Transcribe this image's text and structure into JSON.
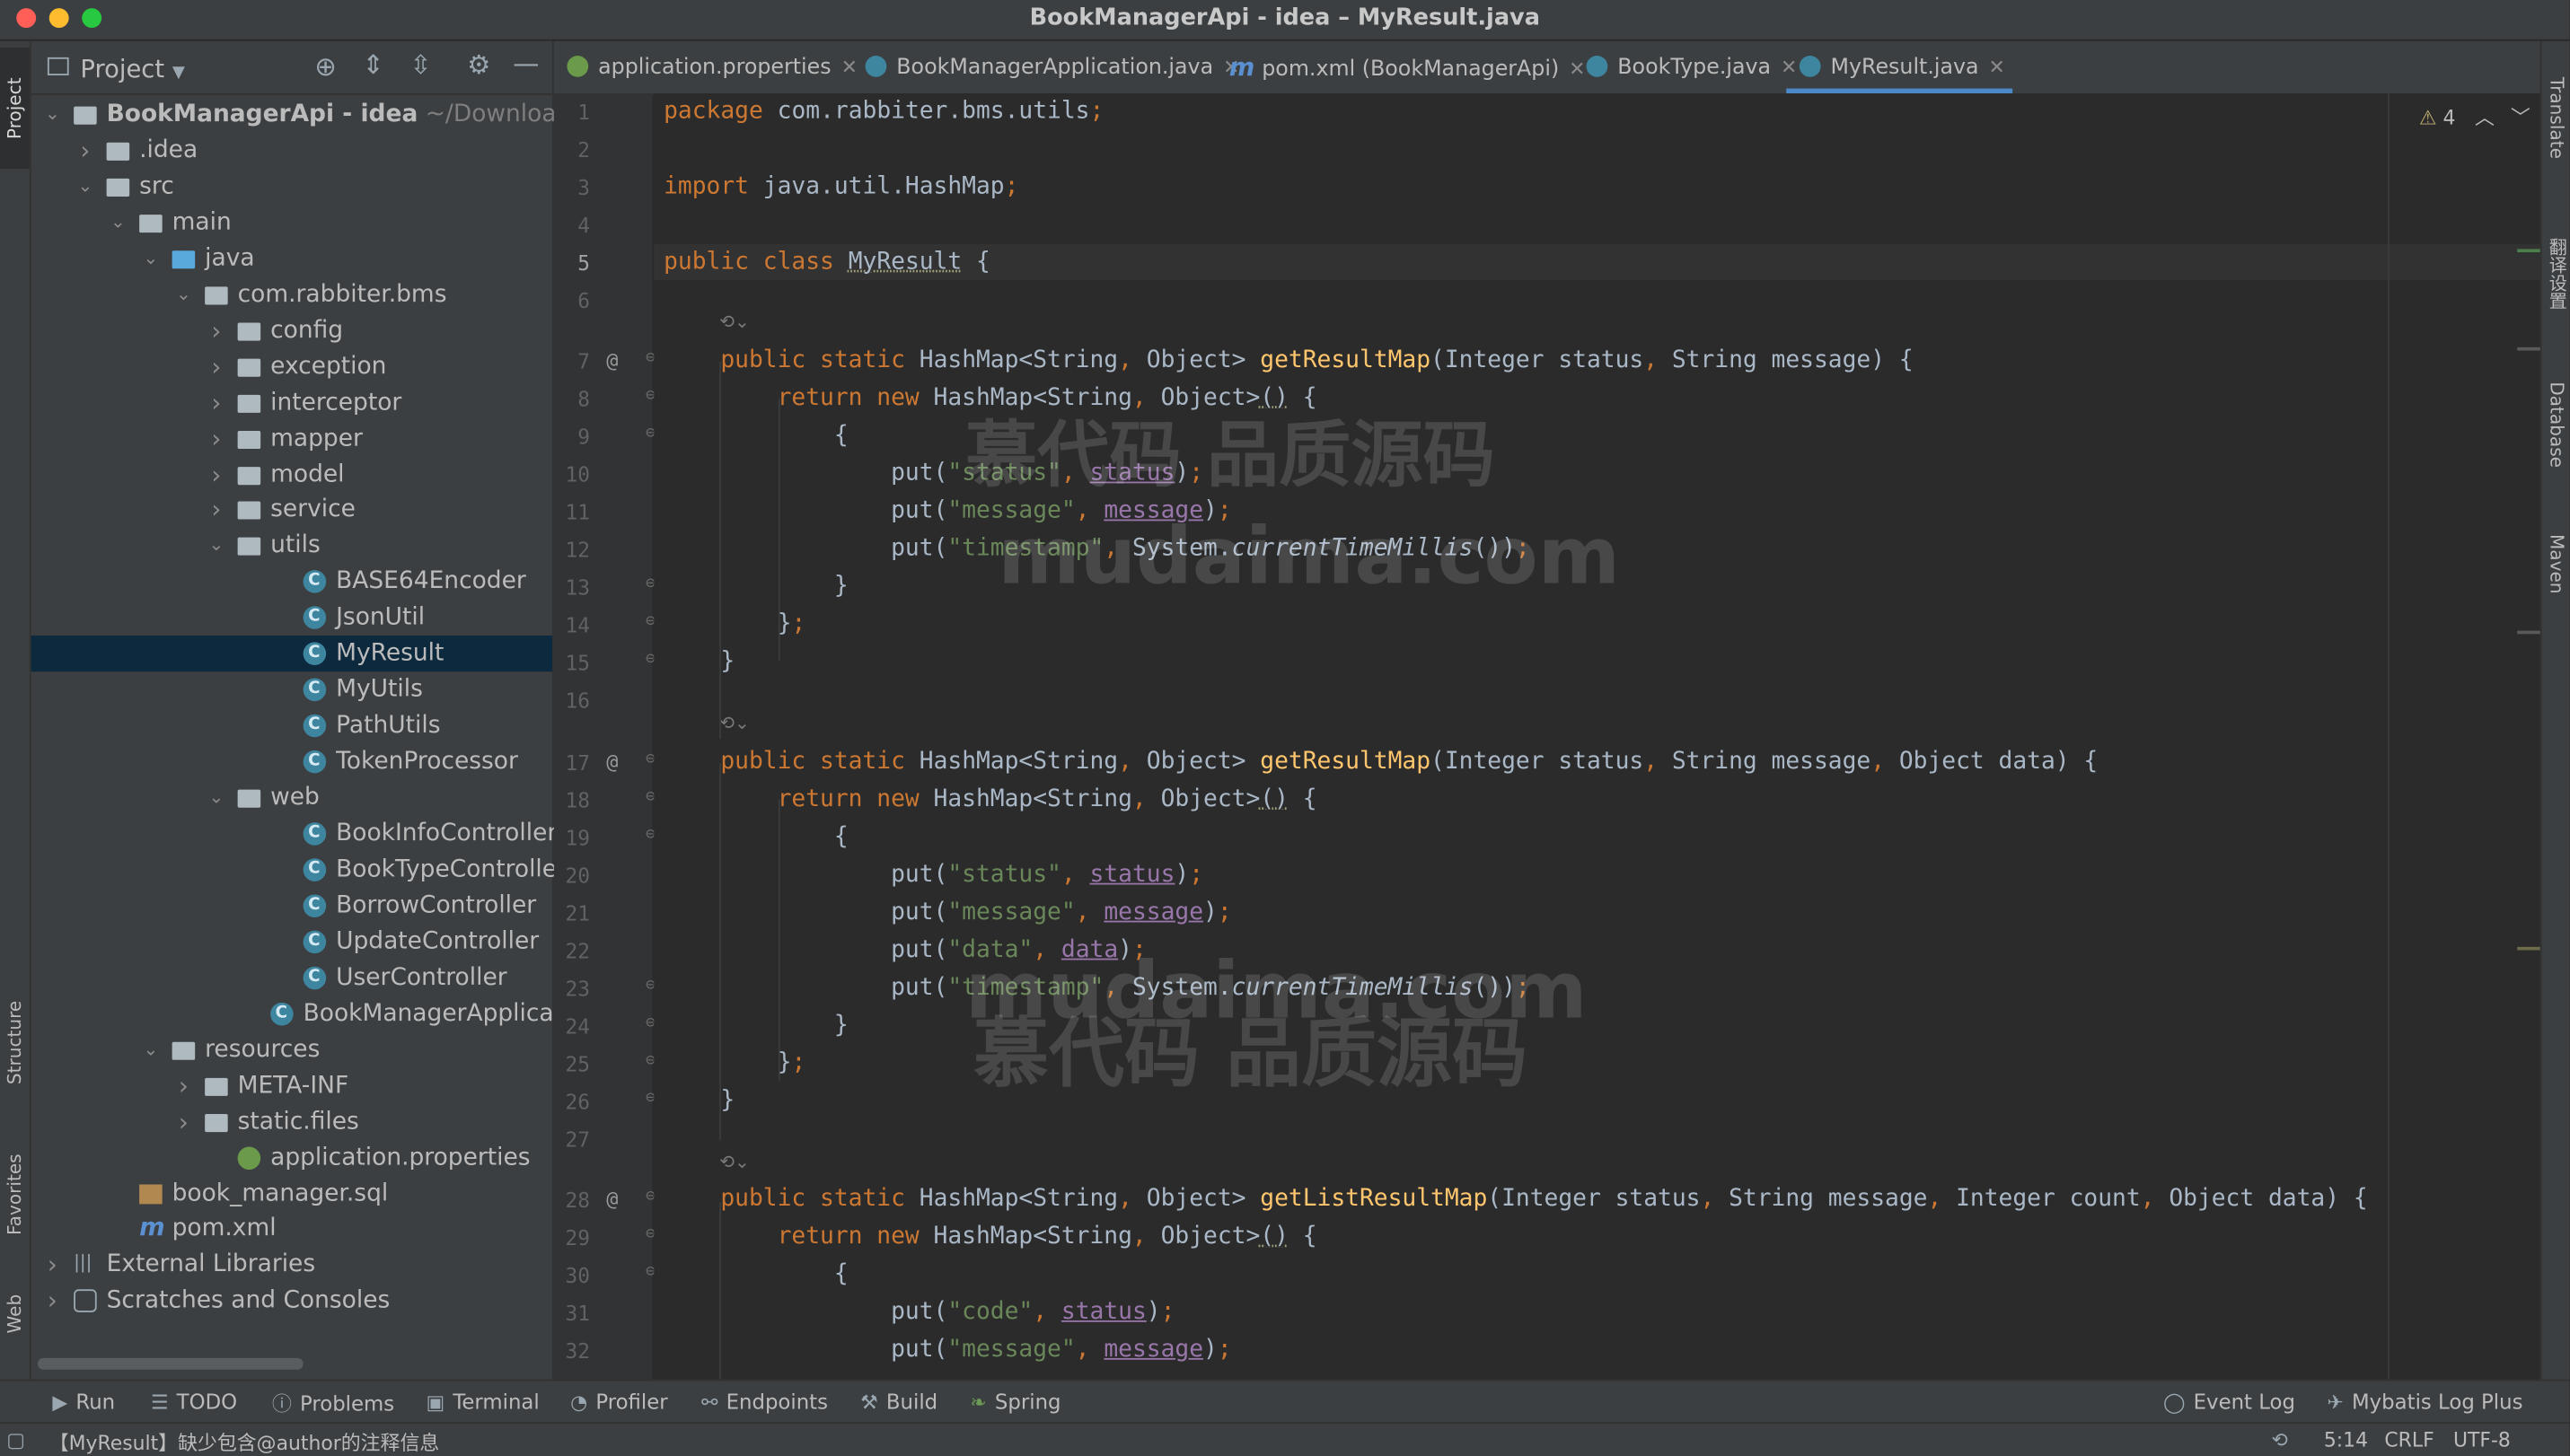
{
  "window": {
    "title": "BookManagerApi - idea – MyResult.java"
  },
  "left_strip": {
    "project": "Project",
    "structure": "Structure",
    "favorites": "Favorites",
    "web": "Web"
  },
  "right_strip": {
    "translate": "Translate",
    "fanyi": "翻译设置",
    "database": "Database",
    "maven": "Maven"
  },
  "project_panel": {
    "title": "Project"
  },
  "tree": [
    {
      "label": "BookManagerApi - idea",
      "hint": "~/Downloads/i",
      "depth": 0,
      "arrow": "open",
      "icon": "folder"
    },
    {
      "label": ".idea",
      "depth": 1,
      "arrow": "closed",
      "icon": "folder"
    },
    {
      "label": "src",
      "depth": 1,
      "arrow": "open",
      "icon": "folder"
    },
    {
      "label": "main",
      "depth": 2,
      "arrow": "open",
      "icon": "folder"
    },
    {
      "label": "java",
      "depth": 3,
      "arrow": "open",
      "icon": "folder-blue"
    },
    {
      "label": "com.rabbiter.bms",
      "depth": 4,
      "arrow": "open",
      "icon": "package"
    },
    {
      "label": "config",
      "depth": 5,
      "arrow": "closed",
      "icon": "package"
    },
    {
      "label": "exception",
      "depth": 5,
      "arrow": "closed",
      "icon": "package"
    },
    {
      "label": "interceptor",
      "depth": 5,
      "arrow": "closed",
      "icon": "package"
    },
    {
      "label": "mapper",
      "depth": 5,
      "arrow": "closed",
      "icon": "package"
    },
    {
      "label": "model",
      "depth": 5,
      "arrow": "closed",
      "icon": "package"
    },
    {
      "label": "service",
      "depth": 5,
      "arrow": "closed",
      "icon": "package"
    },
    {
      "label": "utils",
      "depth": 5,
      "arrow": "open",
      "icon": "package"
    },
    {
      "label": "BASE64Encoder",
      "depth": 7,
      "arrow": "",
      "icon": "class"
    },
    {
      "label": "JsonUtil",
      "depth": 7,
      "arrow": "",
      "icon": "class"
    },
    {
      "label": "MyResult",
      "depth": 7,
      "arrow": "",
      "icon": "class",
      "selected": true
    },
    {
      "label": "MyUtils",
      "depth": 7,
      "arrow": "",
      "icon": "class"
    },
    {
      "label": "PathUtils",
      "depth": 7,
      "arrow": "",
      "icon": "class"
    },
    {
      "label": "TokenProcessor",
      "depth": 7,
      "arrow": "",
      "icon": "class"
    },
    {
      "label": "web",
      "depth": 5,
      "arrow": "open",
      "icon": "package"
    },
    {
      "label": "BookInfoController",
      "depth": 7,
      "arrow": "",
      "icon": "class"
    },
    {
      "label": "BookTypeController",
      "depth": 7,
      "arrow": "",
      "icon": "class"
    },
    {
      "label": "BorrowController",
      "depth": 7,
      "arrow": "",
      "icon": "class"
    },
    {
      "label": "UpdateController",
      "depth": 7,
      "arrow": "",
      "icon": "class"
    },
    {
      "label": "UserController",
      "depth": 7,
      "arrow": "",
      "icon": "class"
    },
    {
      "label": "BookManagerApplication",
      "depth": 6,
      "arrow": "",
      "icon": "class"
    },
    {
      "label": "resources",
      "depth": 3,
      "arrow": "open",
      "icon": "folder"
    },
    {
      "label": "META-INF",
      "depth": 4,
      "arrow": "closed",
      "icon": "folder"
    },
    {
      "label": "static.files",
      "depth": 4,
      "arrow": "closed",
      "icon": "folder"
    },
    {
      "label": "application.properties",
      "depth": 5,
      "arrow": "",
      "icon": "properties"
    },
    {
      "label": "book_manager.sql",
      "depth": 2,
      "arrow": "",
      "icon": "sql"
    },
    {
      "label": "pom.xml",
      "depth": 2,
      "arrow": "",
      "icon": "maven"
    },
    {
      "label": "External Libraries",
      "depth": 0,
      "arrow": "closed",
      "icon": "library"
    },
    {
      "label": "Scratches and Consoles",
      "depth": 0,
      "arrow": "closed",
      "icon": "scratch"
    }
  ],
  "tabs": [
    {
      "label": "application.properties",
      "icon": "properties",
      "active": false
    },
    {
      "label": "BookManagerApplication.java",
      "icon": "class",
      "active": false
    },
    {
      "label": "pom.xml (BookManagerApi)",
      "icon": "maven",
      "active": false
    },
    {
      "label": "BookType.java",
      "icon": "class",
      "active": false
    },
    {
      "label": "MyResult.java",
      "icon": "class",
      "active": true
    }
  ],
  "editor": {
    "warnings": "4",
    "current_line": "5",
    "line_numbers": [
      "1",
      "2",
      "3",
      "4",
      "5",
      "6",
      "7",
      "8",
      "9",
      "10",
      "11",
      "12",
      "13",
      "14",
      "15",
      "16",
      "17",
      "18",
      "19",
      "20",
      "21",
      "22",
      "23",
      "24",
      "25",
      "26",
      "27",
      "28",
      "29",
      "30",
      "31",
      "32"
    ],
    "watermarks": [
      "慕代码 品质源码",
      "mudaima.com"
    ]
  },
  "bottom_bar": {
    "run": "Run",
    "todo": "TODO",
    "problems": "Problems",
    "terminal": "Terminal",
    "profiler": "Profiler",
    "endpoints": "Endpoints",
    "build": "Build",
    "spring": "Spring",
    "event_log": "Event Log",
    "mybatis": "Mybatis Log Plus"
  },
  "status_bar": {
    "message": "【MyResult】缺少包含@author的注释信息",
    "position": "5:14",
    "line_sep": "CRLF",
    "encoding": "UTF-8"
  },
  "colors": {
    "keyword": "#cc7832",
    "string": "#6a8759",
    "method": "#ffc66d",
    "field": "#9876aa",
    "selection": "#0d293e",
    "accent": "#4a88c7"
  }
}
